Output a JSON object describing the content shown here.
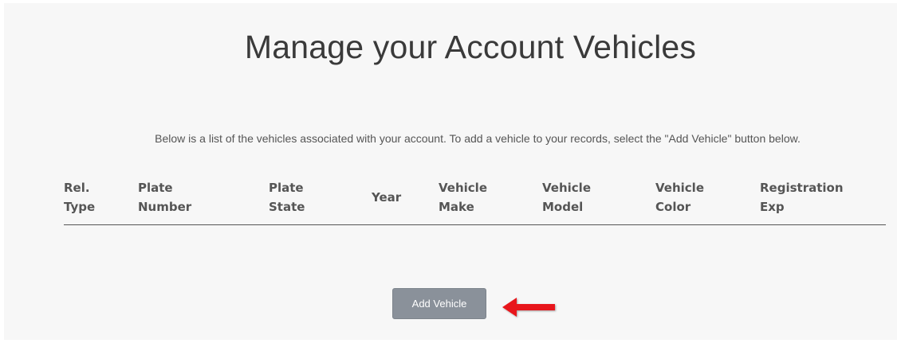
{
  "page": {
    "title": "Manage your Account Vehicles",
    "intro": "Below is a list of the vehicles associated with your account. To add a vehicle to your records, select the \"Add Vehicle\" button below."
  },
  "table": {
    "columns": [
      {
        "line1": "Rel.",
        "line2": "Type"
      },
      {
        "line1": "Plate",
        "line2": "Number"
      },
      {
        "line1": "Plate",
        "line2": "State"
      },
      {
        "line1": "Year",
        "line2": ""
      },
      {
        "line1": "Vehicle",
        "line2": "Make"
      },
      {
        "line1": "Vehicle",
        "line2": "Model"
      },
      {
        "line1": "Vehicle",
        "line2": "Color"
      },
      {
        "line1": "Registration",
        "line2": "Exp"
      }
    ],
    "rows": []
  },
  "actions": {
    "add_vehicle_label": "Add Vehicle"
  },
  "annotation": {
    "arrow_icon": "left-arrow-icon",
    "arrow_color": "#e8161b"
  },
  "colors": {
    "button_bg": "#8a919a",
    "panel_bg": "#f7f7f7",
    "text": "#555555"
  }
}
